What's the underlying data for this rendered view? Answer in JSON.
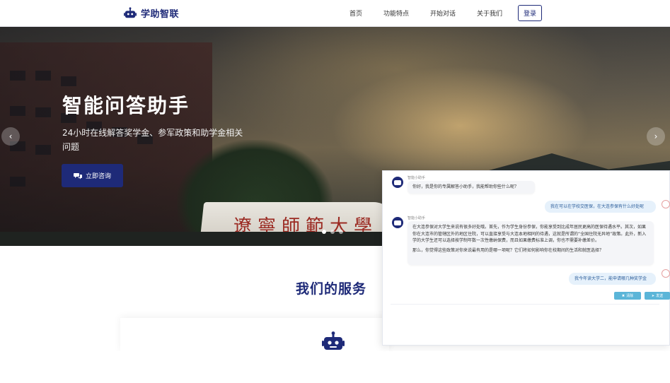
{
  "nav": {
    "brand": "学助智联",
    "links": [
      "首页",
      "功能特点",
      "开始对话",
      "关于我们"
    ],
    "login": "登录"
  },
  "hero": {
    "title": "智能问答助手",
    "subtitle": "24小时在线解答奖学金、参军政策和助学金相关问题",
    "cta": "立即咨询",
    "sign": "遼寧師範大學",
    "slides": 3,
    "active_slide": 1
  },
  "services": {
    "title": "我们的服务"
  },
  "chat": {
    "bot_name": "智能小助手",
    "messages": [
      {
        "role": "bot",
        "text": "你好，我是你的专属解答小助手，我能帮助你些什么呢？"
      },
      {
        "role": "user",
        "text": "我在可以在学校交医保，在大连参保有什么好处呢"
      },
      {
        "role": "bot",
        "text": "在大连参保对大学生来说有很多好处哦。首先，作为学生身份参保，你能享受到比成年居民更高的医保待遇水平。其次，如果你在大连市的管辖区外的地区住院，可以直接享受与大连本地相同的待遇，这就是所谓的“全国住院无异地”政策。此外，新入学的大学生还可以选择按学制年数一次性缴纳保费，而且如果缴费标准上调，你也不需要补缴差价。"
      },
      {
        "role": "bot_cont",
        "text": "那么，你觉得这些政策对你来说最有用的是哪一项呢？它们将如何影响你在校期间的生活和就医选择？"
      },
      {
        "role": "user",
        "text": "我今年读大学二，能申请哪几种奖学金"
      }
    ],
    "clear_label": "清除",
    "send_label": "发送"
  }
}
